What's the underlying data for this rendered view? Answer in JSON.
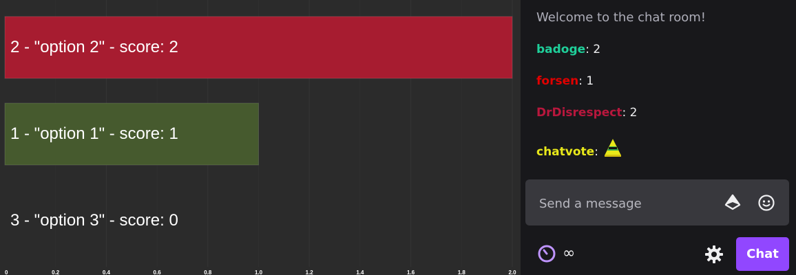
{
  "chart_data": {
    "type": "bar",
    "orientation": "horizontal",
    "categories": [
      "2 - \"option 2\" - score: 2",
      "1 - \"option 1\" - score: 1",
      "3 - \"option 3\" - score: 0"
    ],
    "values": [
      2,
      1,
      0
    ],
    "colors": [
      "#a71c30",
      "#465a2e",
      "#4a4a4a"
    ],
    "xlim": [
      0,
      2.0
    ],
    "xticks": [
      "0",
      "0.2",
      "0.4",
      "0.6",
      "0.8",
      "1.0",
      "1.2",
      "1.4",
      "1.6",
      "1.8",
      "2.0"
    ],
    "grid": true,
    "title": "",
    "xlabel": "",
    "ylabel": ""
  },
  "chat": {
    "welcome": "Welcome to the chat room!",
    "messages": [
      {
        "user": "badoge",
        "color": "#1fcf9a",
        "text": "2"
      },
      {
        "user": "forsen",
        "color": "#e00000",
        "text": "1"
      },
      {
        "user": "DrDisrespect",
        "color": "#b8173d",
        "text": "2"
      },
      {
        "user": "chatvote",
        "color": "#e8e81a",
        "text": "",
        "emote": "cone-emote"
      }
    ],
    "colon": ":",
    "input_placeholder": "Send a message",
    "points_value": "∞",
    "chat_button_label": "Chat",
    "accent": "#9147ff",
    "icons": {
      "bits": "bits-icon",
      "emoji": "emoji-icon",
      "points": "channel-points-icon",
      "settings": "gear-icon"
    }
  }
}
